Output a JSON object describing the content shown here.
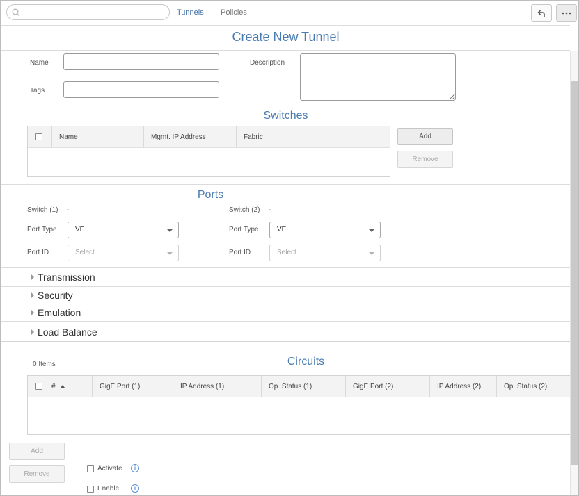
{
  "topbar": {
    "tabs": [
      {
        "label": "Tunnels",
        "active": true
      },
      {
        "label": "Policies",
        "active": false
      }
    ],
    "back_icon": "undo-arrow-icon",
    "more_icon": "more-dots-icon"
  },
  "page": {
    "title": "Create New Tunnel"
  },
  "general": {
    "name_label": "Name",
    "name_value": "",
    "tags_label": "Tags",
    "tags_value": "",
    "description_label": "Description",
    "description_value": ""
  },
  "switches": {
    "title": "Switches",
    "columns": [
      "Name",
      "Mgmt. IP Address",
      "Fabric"
    ],
    "rows": [],
    "add_label": "Add",
    "remove_label": "Remove"
  },
  "ports": {
    "title": "Ports",
    "switch1_label": "Switch (1)",
    "switch1_value": "-",
    "switch2_label": "Switch (2)",
    "switch2_value": "-",
    "port_type_label": "Port Type",
    "port_type1_value": "VE",
    "port_type2_value": "VE",
    "port_id_label": "Port ID",
    "port_id_placeholder": "Select"
  },
  "sections": [
    {
      "label": "Transmission"
    },
    {
      "label": "Security"
    },
    {
      "label": "Emulation"
    },
    {
      "label": "Load Balance"
    }
  ],
  "circuits": {
    "title": "Circuits",
    "count": "0 Items",
    "columns": [
      "#",
      "GigE Port (1)",
      "IP Address (1)",
      "Op. Status (1)",
      "GigE Port (2)",
      "IP Address (2)",
      "Op. Status (2)"
    ],
    "sort_icon": "sort-ascending-icon",
    "rows": [],
    "add_label": "Add",
    "remove_label": "Remove",
    "activate_label": "Activate",
    "enable_label": "Enable",
    "info_glyph": "i"
  },
  "colors": {
    "accent": "#4a7bb0",
    "link_active": "#3f6fa3",
    "info": "#5b8fd1"
  }
}
